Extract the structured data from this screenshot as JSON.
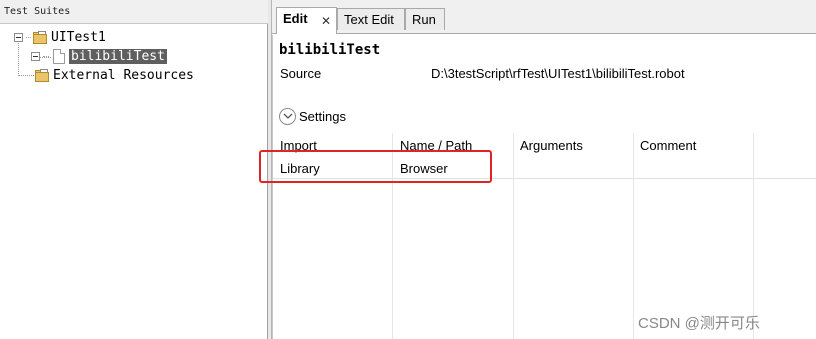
{
  "tree_panel": {
    "header": "Test Suites",
    "items": [
      {
        "label": "UITest1"
      },
      {
        "label": "bilibiliTest"
      },
      {
        "label": "External Resources"
      }
    ]
  },
  "tabs": [
    {
      "label": "Edit",
      "close_glyph": "✕"
    },
    {
      "label": "Text Edit"
    },
    {
      "label": "Run"
    }
  ],
  "editor": {
    "suite_name": "bilibiliTest",
    "source_label": "Source",
    "source_path": "D:\\3testScript\\rfTest\\UITest1\\bilibiliTest.robot",
    "settings_label": "Settings",
    "columns": [
      "Import",
      "Name / Path",
      "Arguments",
      "Comment"
    ],
    "rows": [
      [
        "Library",
        "Browser",
        "",
        ""
      ]
    ]
  },
  "watermark": "CSDN @测开可乐",
  "colors": {
    "highlight": "#e02424",
    "selection": "#5f5f5f"
  },
  "icons": {
    "folder": "folder-icon",
    "file": "file-icon",
    "collapse": "collapse-icon",
    "settings_toggle": "chevron-down-icon"
  }
}
